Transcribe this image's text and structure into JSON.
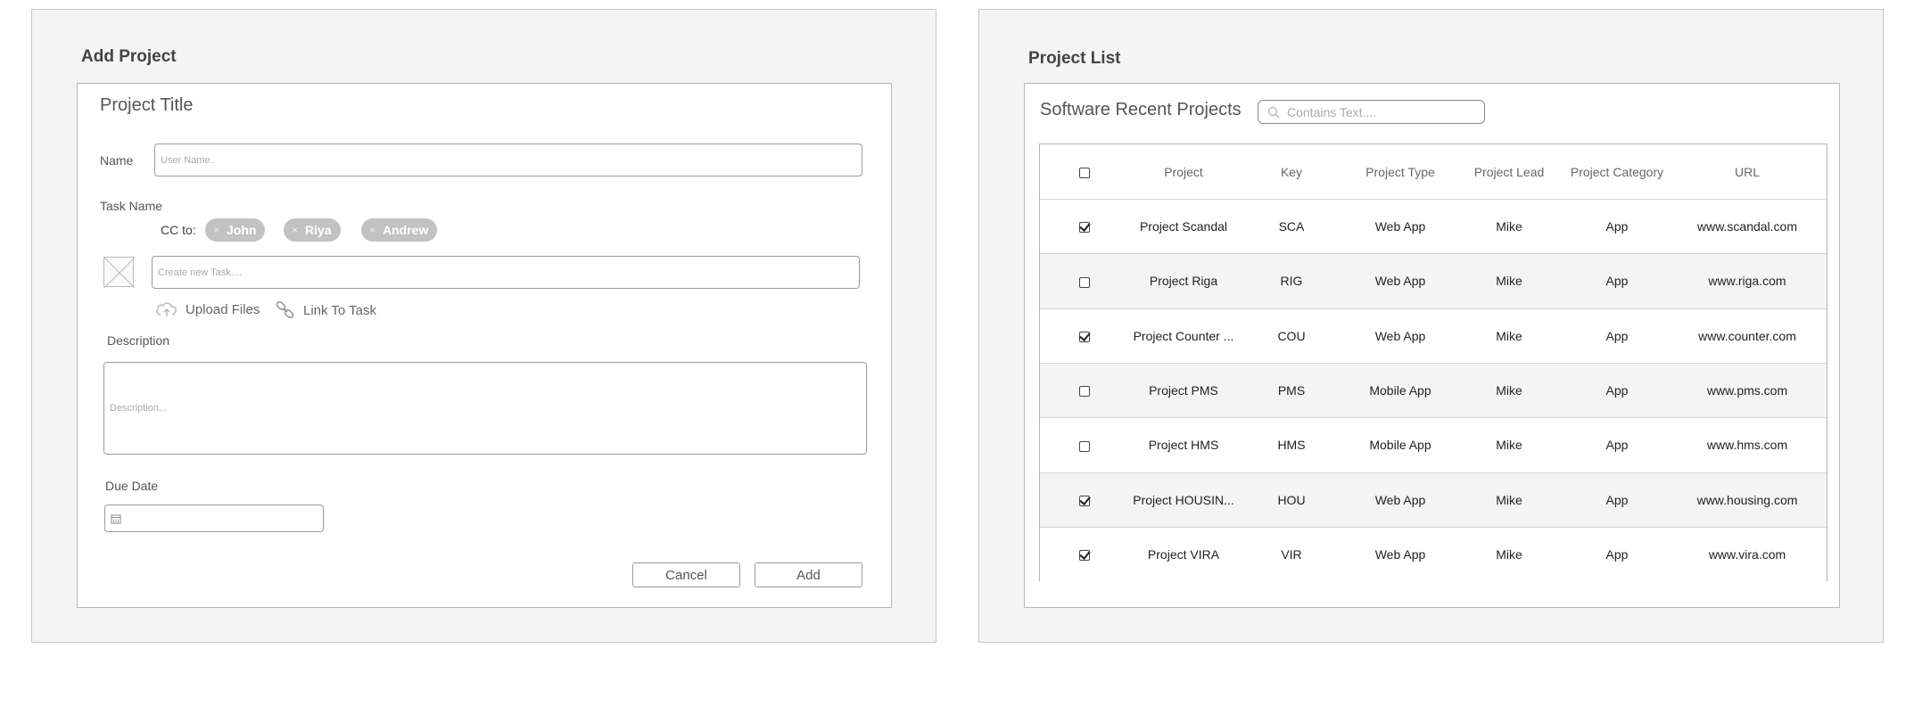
{
  "add_project": {
    "title": "Add Project",
    "card_title": "Project Title",
    "name_label": "Name",
    "name_placeholder": "User Name..",
    "task_name_label": "Task Name",
    "cc_label": "CC to:",
    "cc_chips": [
      "John",
      "Riya",
      "Andrew"
    ],
    "chip_remove_glyph": "×",
    "task_placeholder": "Create new Task....",
    "upload_label": "Upload Files",
    "link_label": "Link To Task",
    "description_label": "Description",
    "description_placeholder": "Description...",
    "due_date_label": "Due Date",
    "cancel_label": "Cancel",
    "add_label": "Add"
  },
  "project_list": {
    "title": "Project List",
    "card_title": "Software Recent Projects",
    "search_placeholder": "Contains Text....",
    "columns": [
      "Project",
      "Key",
      "Project Type",
      "Project Lead",
      "Project Category",
      "URL"
    ],
    "rows": [
      {
        "checked": true,
        "project": "Project Scandal",
        "key": "SCA",
        "type": "Web App",
        "lead": "Mike",
        "category": "App",
        "url": "www.scandal.com"
      },
      {
        "checked": false,
        "project": "Project Riga",
        "key": "RIG",
        "type": "Web App",
        "lead": "Mike",
        "category": "App",
        "url": "www.riga.com"
      },
      {
        "checked": true,
        "project": "Project Counter ...",
        "key": "COU",
        "type": "Web App",
        "lead": "Mike",
        "category": "App",
        "url": "www.counter.com"
      },
      {
        "checked": false,
        "project": "Project PMS",
        "key": "PMS",
        "type": "Mobile App",
        "lead": "Mike",
        "category": "App",
        "url": "www.pms.com"
      },
      {
        "checked": false,
        "project": "Project HMS",
        "key": "HMS",
        "type": "Mobile App",
        "lead": "Mike",
        "category": "App",
        "url": "www.hms.com"
      },
      {
        "checked": true,
        "project": "Project HOUSIN...",
        "key": "HOU",
        "type": "Web App",
        "lead": "Mike",
        "category": "App",
        "url": "www.housing.com"
      },
      {
        "checked": true,
        "project": "Project  VIRA",
        "key": "VIR",
        "type": "Web App",
        "lead": "Mike",
        "category": "App",
        "url": "www.vira.com"
      }
    ]
  }
}
